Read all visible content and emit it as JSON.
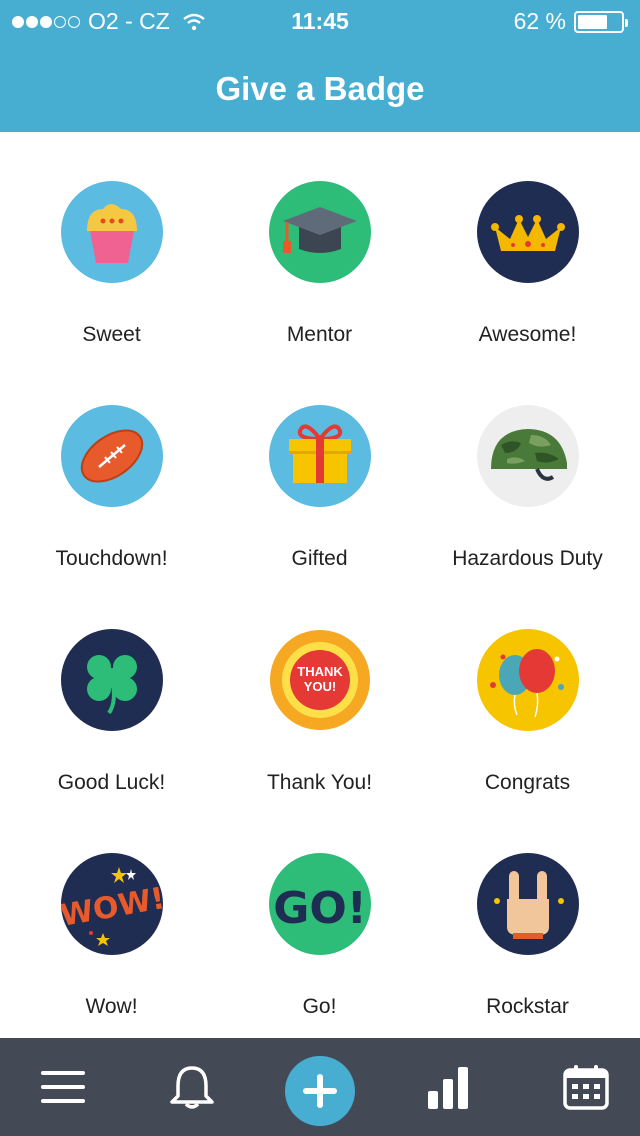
{
  "status": {
    "carrier": "O2 - CZ",
    "time": "11:45",
    "battery": "62 %",
    "signal_bars": 3,
    "battery_level": 0.62
  },
  "header": {
    "title": "Give a Badge"
  },
  "badges": [
    {
      "label": "Sweet",
      "icon": "cupcake-icon",
      "bg": "#5bbbe0"
    },
    {
      "label": "Mentor",
      "icon": "graduation-cap-icon",
      "bg": "#2dbd79"
    },
    {
      "label": "Awesome!",
      "icon": "crown-icon",
      "bg": "#1f2d52"
    },
    {
      "label": "Touchdown!",
      "icon": "football-icon",
      "bg": "#5bbbe0"
    },
    {
      "label": "Gifted",
      "icon": "gift-icon",
      "bg": "#5bbbe0"
    },
    {
      "label": "Hazardous Duty",
      "icon": "helmet-icon",
      "bg": "#eeeeee"
    },
    {
      "label": "Good Luck!",
      "icon": "clover-icon",
      "bg": "#1f2d52"
    },
    {
      "label": "Thank You!",
      "icon": "thank-you-seal-icon",
      "bg": "#f6a822",
      "text": "THANK YOU!"
    },
    {
      "label": "Congrats",
      "icon": "balloons-icon",
      "bg": "#f7c400"
    },
    {
      "label": "Wow!",
      "icon": "wow-icon",
      "bg": "#1f2d52",
      "text": "WOW!"
    },
    {
      "label": "Go!",
      "icon": "go-icon",
      "bg": "#2dbd79",
      "text": "GO!"
    },
    {
      "label": "Rockstar",
      "icon": "rock-hand-icon",
      "bg": "#1f2d52"
    }
  ],
  "tabbar": {
    "items": [
      "menu-icon",
      "bell-icon",
      "plus-icon",
      "stats-icon",
      "calendar-icon"
    ]
  }
}
